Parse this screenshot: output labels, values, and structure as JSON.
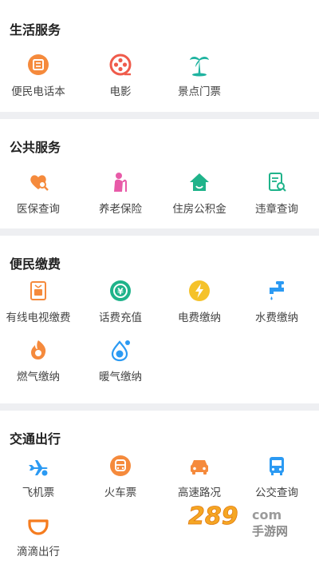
{
  "sections": [
    {
      "title": "生活服务",
      "items": [
        {
          "label": "便民电话本",
          "icon": "phone-book-icon",
          "color": "#f58a3c"
        },
        {
          "label": "电影",
          "icon": "film-reel-icon",
          "color": "#ef5b4b"
        },
        {
          "label": "景点门票",
          "icon": "palm-tree-icon",
          "color": "#1fb3a0"
        }
      ]
    },
    {
      "title": "公共服务",
      "items": [
        {
          "label": "医保查询",
          "icon": "heart-search-icon",
          "color": "#f58a3c"
        },
        {
          "label": "养老保险",
          "icon": "elderly-icon",
          "color": "#e85aa8"
        },
        {
          "label": "住房公积金",
          "icon": "house-icon",
          "color": "#1fb38a"
        },
        {
          "label": "违章查询",
          "icon": "document-search-icon",
          "color": "#1fb38a"
        }
      ]
    },
    {
      "title": "便民缴费",
      "items": [
        {
          "label": "有线电视缴费",
          "icon": "tv-icon",
          "color": "#f58a3c"
        },
        {
          "label": "话费充值",
          "icon": "phone-charge-icon",
          "color": "#1fb38a"
        },
        {
          "label": "电费缴纳",
          "icon": "lightning-icon",
          "color": "#f5c22a"
        },
        {
          "label": "水费缴纳",
          "icon": "faucet-icon",
          "color": "#2b9af3"
        },
        {
          "label": "燃气缴纳",
          "icon": "flame-icon",
          "color": "#f58a3c"
        },
        {
          "label": "暖气缴纳",
          "icon": "water-drop-icon",
          "color": "#2b9af3"
        }
      ]
    },
    {
      "title": "交通出行",
      "items": [
        {
          "label": "飞机票",
          "icon": "airplane-icon",
          "color": "#2b9af3"
        },
        {
          "label": "火车票",
          "icon": "train-icon",
          "color": "#f58a3c"
        },
        {
          "label": "高速路况",
          "icon": "car-icon",
          "color": "#f58a3c"
        },
        {
          "label": "公交查询",
          "icon": "bus-icon",
          "color": "#2b9af3"
        },
        {
          "label": "滴滴出行",
          "icon": "didi-icon",
          "color": "#f57c1f"
        }
      ]
    }
  ],
  "watermark": {
    "main": "289.com",
    "sub": "手游网"
  }
}
